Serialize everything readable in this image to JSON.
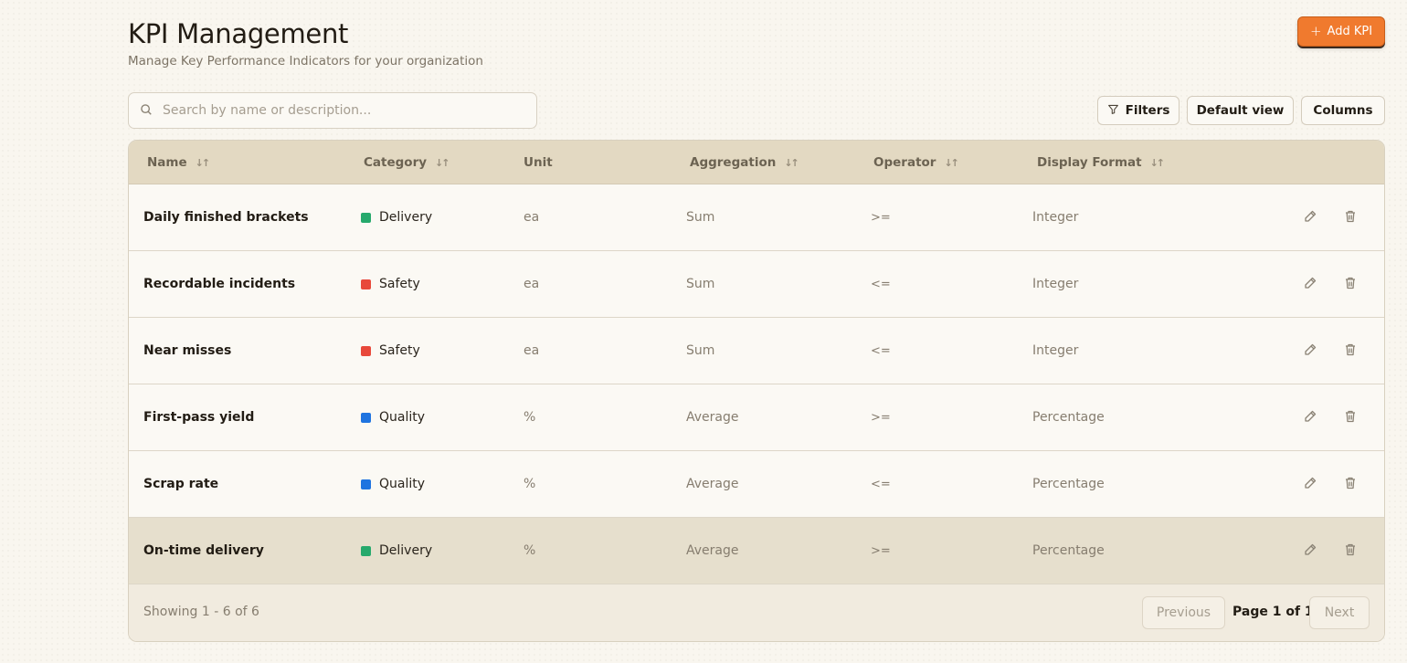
{
  "header": {
    "title": "KPI Management",
    "subtitle": "Manage Key Performance Indicators for your organization",
    "add_button": "Add KPI"
  },
  "toolbar": {
    "search_placeholder": "Search by name or description...",
    "filters_label": "Filters",
    "default_view_label": "Default view",
    "columns_label": "Columns"
  },
  "table": {
    "columns": [
      "Name",
      "Category",
      "Unit",
      "Aggregation",
      "Operator",
      "Display Format"
    ],
    "rows": [
      {
        "name": "Daily finished brackets",
        "category": "Delivery",
        "category_color": "#26a96c",
        "unit": "ea",
        "aggregation": "Sum",
        "operator": ">=",
        "format": "Integer"
      },
      {
        "name": "Recordable incidents",
        "category": "Safety",
        "category_color": "#e8483a",
        "unit": "ea",
        "aggregation": "Sum",
        "operator": "<=",
        "format": "Integer"
      },
      {
        "name": "Near misses",
        "category": "Safety",
        "category_color": "#e8483a",
        "unit": "ea",
        "aggregation": "Sum",
        "operator": "<=",
        "format": "Integer"
      },
      {
        "name": "First-pass yield",
        "category": "Quality",
        "category_color": "#1f74e0",
        "unit": "%",
        "aggregation": "Average",
        "operator": ">=",
        "format": "Percentage"
      },
      {
        "name": "Scrap rate",
        "category": "Quality",
        "category_color": "#1f74e0",
        "unit": "%",
        "aggregation": "Average",
        "operator": "<=",
        "format": "Percentage"
      },
      {
        "name": "On-time delivery",
        "category": "Delivery",
        "category_color": "#26a96c",
        "unit": "%",
        "aggregation": "Average",
        "operator": ">=",
        "format": "Percentage"
      }
    ]
  },
  "pagination": {
    "showing": "Showing 1 - 6 of 6",
    "previous_label": "Previous",
    "page_info": "Page 1 of 1",
    "next_label": "Next"
  },
  "colors": {
    "accent": "#f07a2e",
    "header_bg": "#e3d9c2",
    "highlight_row": "#e6dfcd"
  }
}
